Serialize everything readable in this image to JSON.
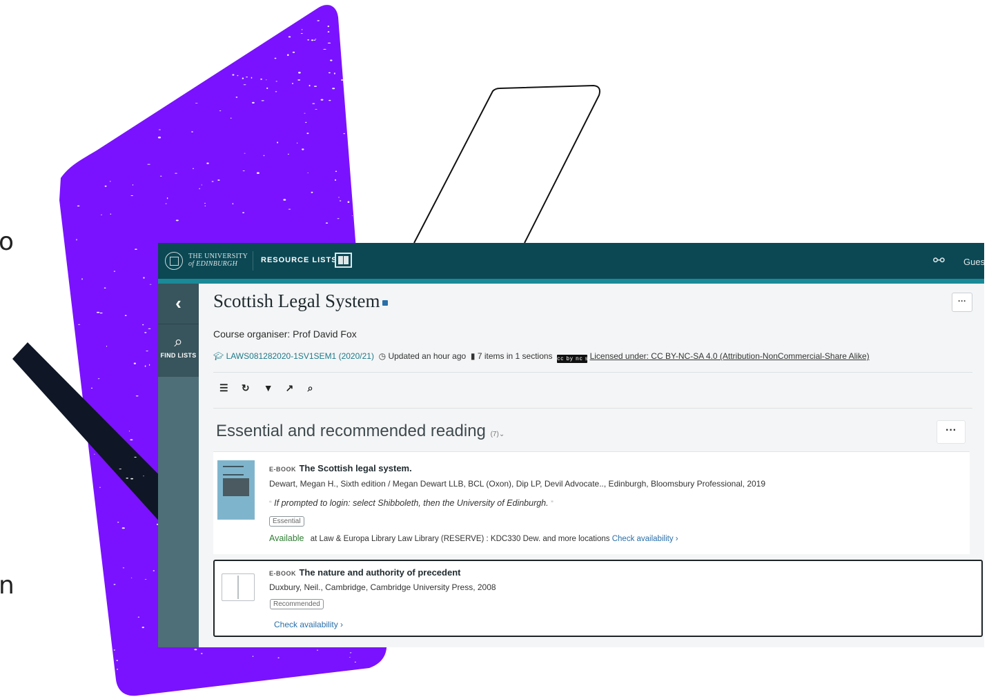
{
  "edge_chars": [
    "o",
    "n"
  ],
  "header": {
    "university_line1": "THE UNIVERSITY",
    "university_line2": "of EDINBURGH",
    "product": "RESOURCE LISTS",
    "user": "Guest",
    "link_icon": "link-icon"
  },
  "sidebar": {
    "back_icon": "‹",
    "find_label": "FIND LISTS"
  },
  "list": {
    "title": "Scottish Legal System",
    "organiser": "Course organiser: Prof David Fox",
    "course_code": "LAWS081282020-1SV1SEM1 (2020/21)",
    "updated": "Updated an hour ago",
    "items_count": "7 items in 1 sections",
    "license": "Licensed under: CC BY-NC-SA 4.0 (Attribution-NonCommercial-Share Alike)",
    "more_label": "···"
  },
  "toolbar": {
    "icons": [
      "list-icon",
      "refresh-icon",
      "filter-icon",
      "collapse-icon",
      "search-icon"
    ]
  },
  "section": {
    "title": "Essential and recommended reading",
    "count": "(7)",
    "more_label": "···"
  },
  "items": [
    {
      "type": "E-BOOK",
      "title": "The Scottish legal system.",
      "authors": "Dewart, Megan H., Sixth edition / Megan Dewart LLB, BCL (Oxon), Dip LP, Devil Advocate.., Edinburgh, Bloomsbury Professional, 2019",
      "note": "If prompted to login: select Shibboleth, then the University of Edinburgh.",
      "badge": "Essential",
      "availability": "Available",
      "location": "at Law & Europa Library Law Library (RESERVE) : KDC330 Dew. and more locations",
      "check": "Check availability ›"
    },
    {
      "type": "E-BOOK",
      "title": "The nature and authority of precedent",
      "authors": "Duxbury, Neil., Cambridge, Cambridge University Press, 2008",
      "badge": "Recommended",
      "check": "Check availability ›"
    }
  ],
  "colors": {
    "header_bg": "#0b4854",
    "header_accent": "#1a8a98",
    "sidebar_bg": "#4e6f78",
    "decor_purple": "#7a12ff",
    "available_green": "#2e7d32",
    "link_blue": "#2a6fa8"
  }
}
